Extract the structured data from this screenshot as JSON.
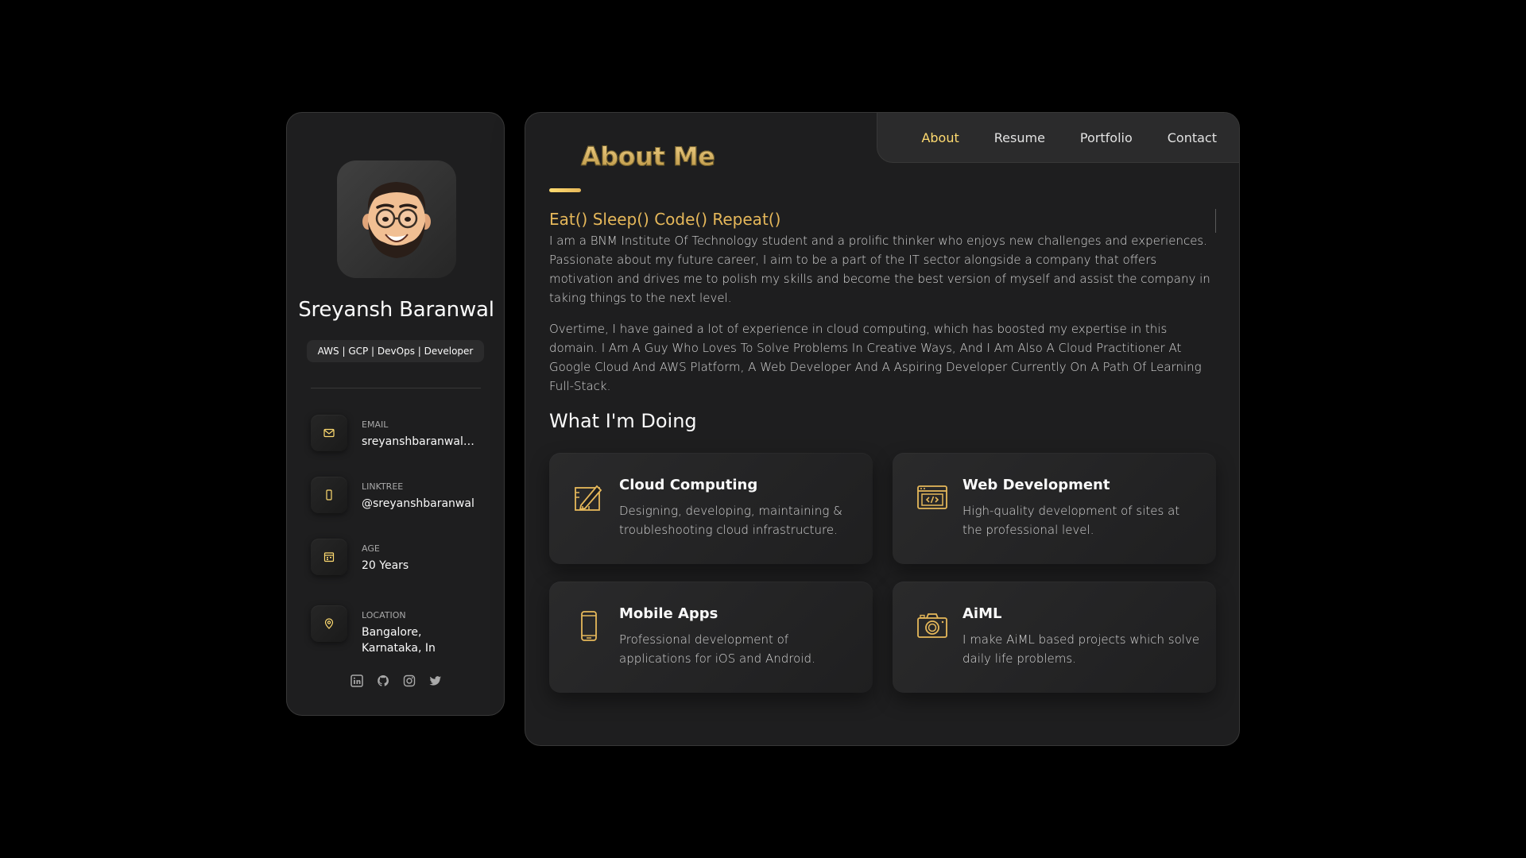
{
  "sidebar": {
    "avatar_alt": "avatar",
    "name": "Sreyansh Baranwal",
    "title": "AWS | GCP | DevOps | Developer",
    "contacts": [
      {
        "label": "EMAIL",
        "value": "sreyanshbaranwal…",
        "icon": "mail-icon"
      },
      {
        "label": "LINKTREE",
        "value": "@sreyanshbaranwal",
        "icon": "phone-icon"
      },
      {
        "label": "AGE",
        "value": "20 Years",
        "icon": "calendar-icon"
      },
      {
        "label": "LOCATION",
        "value": "Bangalore, Karnataka, In",
        "icon": "location-pin-icon"
      }
    ],
    "socials": [
      "linkedin-icon",
      "github-icon",
      "instagram-icon",
      "twitter-icon"
    ]
  },
  "navbar": {
    "items": [
      "About",
      "Resume",
      "Portfolio",
      "Contact"
    ],
    "active": "About"
  },
  "about": {
    "title": "About Me",
    "tagline": "Eat() Sleep() Code() Repeat()",
    "paragraph1": "I am a BNM Institute Of Technology student and a prolific thinker who enjoys new challenges and experiences. Passionate about my future career, I aim to be a part of the IT sector alongside a company that offers motivation and drives me to polish my skills and become the best version of myself and assist the company in taking things to the next level.",
    "paragraph2": "Overtime, I have gained a lot of experience in cloud computing, which has boosted my expertise in this domain. I Am A Guy Who Loves To Solve Problems In Creative Ways, And I Am Also A Cloud Practitioner At Google Cloud And AWS Platform, A Web Developer And A Aspiring Developer Currently On A Path Of Learning Full-Stack."
  },
  "services": {
    "title": "What I'm Doing",
    "items": [
      {
        "title": "Cloud Computing",
        "text": "Designing, developing, maintaining & troubleshooting cloud infrastructure.",
        "icon": "design-pencil-icon"
      },
      {
        "title": "Web Development",
        "text": "High-quality development of sites at the professional level.",
        "icon": "code-window-icon"
      },
      {
        "title": "Mobile Apps",
        "text": "Professional development of applications for iOS and Android.",
        "icon": "mobile-phone-icon"
      },
      {
        "title": "AiML",
        "text": "I make AiML based projects which solve daily life problems.",
        "icon": "camera-icon"
      }
    ]
  },
  "colors": {
    "accent": "#ffdb70",
    "accent_dark": "#e6b85a",
    "background": "#000000",
    "card": "#1e1e1f"
  }
}
